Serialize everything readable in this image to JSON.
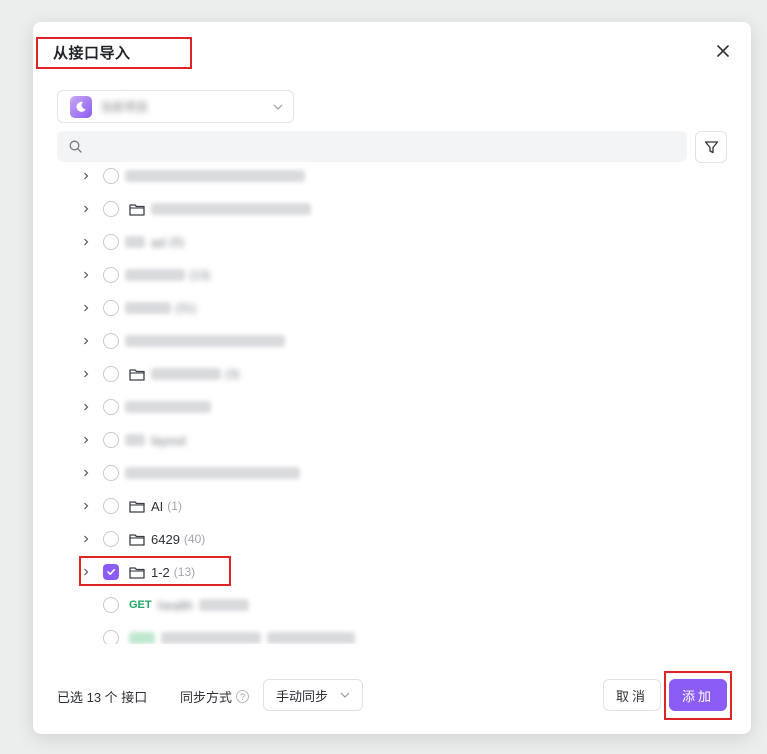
{
  "modal": {
    "title": "从接口导入"
  },
  "project_select": {
    "value": "当前项目"
  },
  "search": {
    "placeholder": ""
  },
  "tree": {
    "items": [
      {
        "label": "",
        "count": "",
        "obscured": true
      },
      {
        "label": "",
        "count": "",
        "obscured": true
      },
      {
        "label": "ad",
        "count": "(5)",
        "obscured": true
      },
      {
        "label": "",
        "count": "(13)",
        "obscured": true
      },
      {
        "label": "",
        "count": "(31)",
        "obscured": true
      },
      {
        "label": "",
        "count": "",
        "obscured": true
      },
      {
        "label": "",
        "count": "(3)",
        "obscured": true
      },
      {
        "label": "",
        "count": "",
        "obscured": true
      },
      {
        "label": "layout",
        "count": "",
        "obscured": true
      },
      {
        "label": "",
        "count": "",
        "obscured": true
      },
      {
        "label": "AI",
        "count": "(1)",
        "obscured": false
      },
      {
        "label": "6429",
        "count": "(40)",
        "obscured": false
      },
      {
        "label": "1-2",
        "count": "(13)",
        "obscured": false,
        "checked": true
      }
    ],
    "api_items": [
      {
        "method": "GET",
        "name": "health"
      },
      {
        "method": "",
        "name": ""
      }
    ]
  },
  "footer": {
    "selected_text": "已选 13 个 接口",
    "sync_label": "同步方式",
    "sync_value": "手动同步",
    "cancel_label": "取消",
    "add_label": "添加"
  },
  "colors": {
    "accent": "#8b5cf6",
    "get_method": "#1ea660",
    "highlight": "#e02424"
  }
}
